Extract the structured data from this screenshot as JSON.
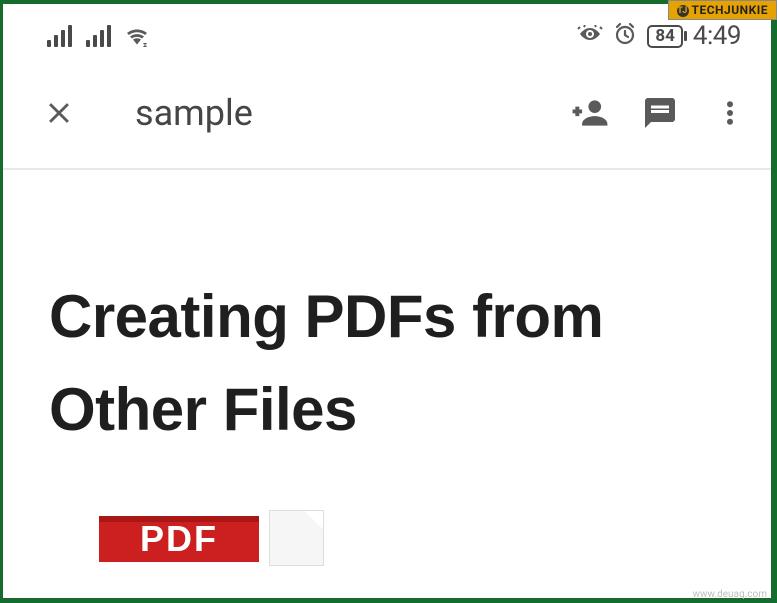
{
  "watermarks": {
    "top_brand": "TECHJUNKIE",
    "bottom_url": "www.deuaq.com"
  },
  "status_bar": {
    "battery_pct": "84",
    "time": "4:49"
  },
  "app_bar": {
    "title": "sample"
  },
  "document": {
    "heading": "Creating PDFs from Other Files",
    "pdf_label": "PDF"
  }
}
